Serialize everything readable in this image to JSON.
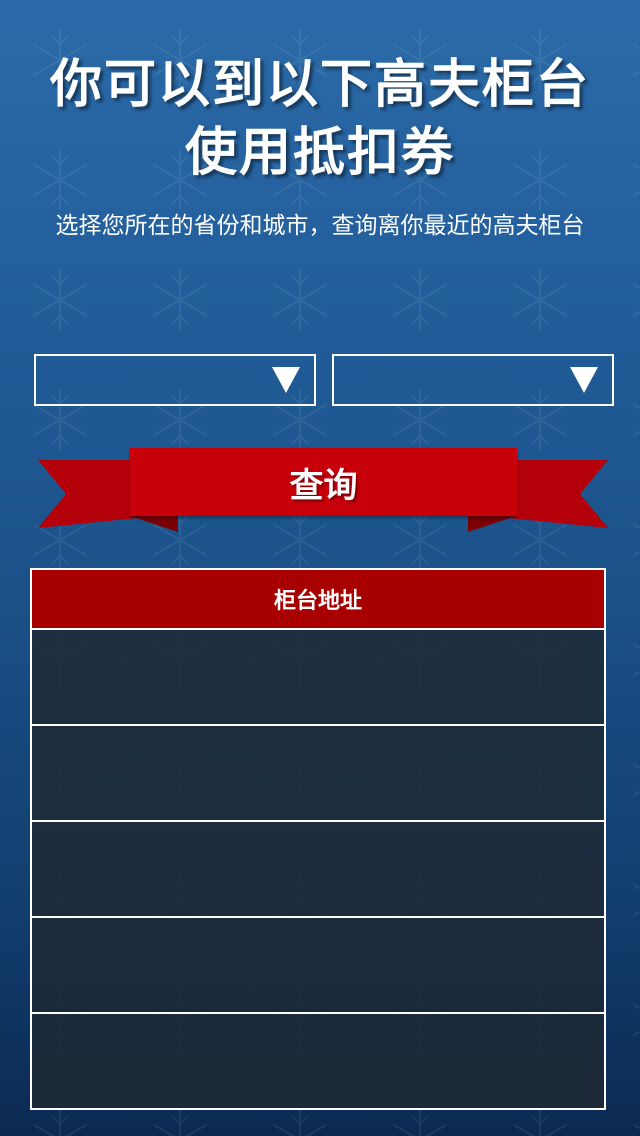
{
  "header": {
    "title_line1": "你可以到以下高夫柜台",
    "title_line2": "使用抵扣券",
    "subtitle": "选择您所在的省份和城市，查询离你最近的高夫柜台"
  },
  "filters": {
    "province_value": "",
    "city_value": ""
  },
  "query_button": {
    "label": "查询"
  },
  "results_table": {
    "header": "柜台地址",
    "rows": [
      "",
      "",
      "",
      "",
      ""
    ]
  },
  "colors": {
    "background_top": "#2b6aa8",
    "background_bottom": "#0b2a52",
    "ribbon_red": "#c8000a",
    "table_header_red": "#a80000"
  }
}
